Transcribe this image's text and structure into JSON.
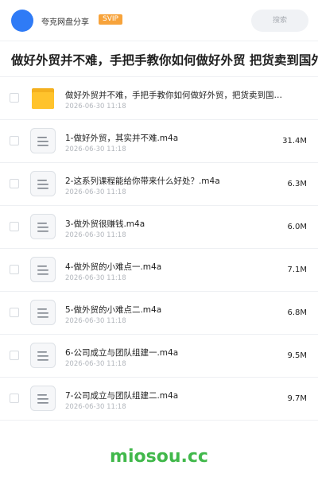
{
  "header": {
    "username": "夸克网盘分享",
    "badge": "SVIP",
    "search_placeholder": "搜索",
    "avatar_color": "#2f7bf6"
  },
  "folder_title": "做好外贸并不难，手把手教你如何做好外贸 把货卖到国外其",
  "items": [
    {
      "type": "folder",
      "icon": "folder-icon",
      "name": "做好外贸并不难，手把手教你如何做好外贸，把货卖到国…",
      "date": "2026-06-30 11:18",
      "size": ""
    },
    {
      "type": "file",
      "icon": "document-icon",
      "name": "1-做好外贸，其实并不难.m4a",
      "date": "2026-06-30 11:18",
      "size": "31.4M"
    },
    {
      "type": "file",
      "icon": "document-icon",
      "name": "2-这系列课程能给你带来什么好处？.m4a",
      "date": "2026-06-30 11:18",
      "size": "6.3M"
    },
    {
      "type": "file",
      "icon": "document-icon",
      "name": "3-做外贸很赚钱.m4a",
      "date": "2026-06-30 11:18",
      "size": "6.0M"
    },
    {
      "type": "file",
      "icon": "document-icon",
      "name": "4-做外贸的小难点一.m4a",
      "date": "2026-06-30 11:18",
      "size": "7.1M"
    },
    {
      "type": "file",
      "icon": "document-icon",
      "name": "5-做外贸的小难点二.m4a",
      "date": "2026-06-30 11:18",
      "size": "6.8M"
    },
    {
      "type": "file",
      "icon": "document-icon",
      "name": "6-公司成立与团队组建一.m4a",
      "date": "2026-06-30 11:18",
      "size": "9.5M"
    },
    {
      "type": "file",
      "icon": "document-icon",
      "name": "7-公司成立与团队组建二.m4a",
      "date": "2026-06-30 11:18",
      "size": "9.7M"
    }
  ],
  "watermark": "miosou.cc",
  "colors": {
    "folder": "#ffc32c",
    "badge": "#f7a33b",
    "watermark": "#41b84b"
  }
}
